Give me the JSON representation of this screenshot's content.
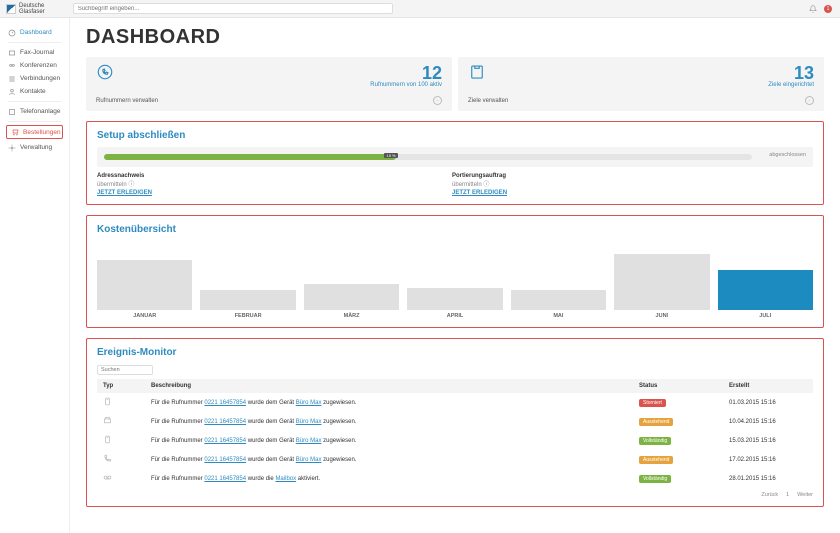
{
  "logo": {
    "line1": "Deutsche",
    "line2": "Glasfaser"
  },
  "search_placeholder": "Suchbegriff eingeben...",
  "notif_count": "1",
  "sidebar": {
    "items": [
      {
        "label": "Dashboard"
      },
      {
        "label": "Fax-Journal"
      },
      {
        "label": "Konferenzen"
      },
      {
        "label": "Verbindungen"
      },
      {
        "label": "Kontakte"
      },
      {
        "label": "Telefonanlage"
      },
      {
        "label": "Bestellungen"
      },
      {
        "label": "Verwaltung"
      }
    ]
  },
  "title": "DASHBOARD",
  "stats": [
    {
      "num": "12",
      "sub": "Rufnummern von 100 aktiv",
      "foot": "Rufnummern verwalten"
    },
    {
      "num": "13",
      "sub": "Ziele eingerichtet",
      "foot": "Ziele verwalten"
    }
  ],
  "setup": {
    "heading": "Setup abschließen",
    "percent": "15 %",
    "end": "abgeschlossen",
    "cols": [
      {
        "title": "Adressnachweis",
        "sub": "übermitteln ⓘ",
        "link": "JETZT ERLEDIGEN"
      },
      {
        "title": "Portierungsauftrag",
        "sub": "übermitteln ⓘ",
        "link": "JETZT ERLEDIGEN"
      }
    ]
  },
  "costs": {
    "heading": "Kostenübersicht"
  },
  "chart_data": {
    "type": "bar",
    "categories": [
      "JANUAR",
      "FEBRUAR",
      "MÄRZ",
      "APRIL",
      "MAI",
      "JUNI",
      "JULI"
    ],
    "values": [
      70,
      28,
      36,
      30,
      28,
      78,
      56
    ],
    "active_index": 6,
    "title": "Kostenübersicht",
    "xlabel": "",
    "ylabel": "",
    "ylim": [
      0,
      100
    ]
  },
  "events": {
    "heading": "Ereignis-Monitor",
    "search_placeholder": "Suchen",
    "headers": {
      "typ": "Typ",
      "desc": "Beschreibung",
      "status": "Status",
      "created": "Erstellt"
    },
    "rows": [
      {
        "icon": "phone-add",
        "pre": "Für die Rufnummer ",
        "num": "0221 16457854",
        "mid": " wurde dem Gerät ",
        "dev": "Büro Max",
        "post": " zugewiesen.",
        "status": "Storniert",
        "cls": "red",
        "date": "01.03.2015 15:16"
      },
      {
        "icon": "fax",
        "pre": "Für die Rufnummer ",
        "num": "0221 16457854",
        "mid": " wurde dem Gerät ",
        "dev": "Büro Max",
        "post": " zugewiesen.",
        "status": "Ausstehend",
        "cls": "orange",
        "date": "10.04.2015 15:16"
      },
      {
        "icon": "phone-add",
        "pre": "Für die Rufnummer ",
        "num": "0221 16457854",
        "mid": " wurde dem Gerät ",
        "dev": "Büro Max",
        "post": " zugewiesen.",
        "status": "Vollständig",
        "cls": "green",
        "date": "15.03.2015 15:16"
      },
      {
        "icon": "handset",
        "pre": "Für die Rufnummer ",
        "num": "0221 16457854",
        "mid": " wurde dem Gerät ",
        "dev": "Büro Max",
        "post": " zugewiesen.",
        "status": "Ausstehend",
        "cls": "orange",
        "date": "17.02.2015 15:16"
      },
      {
        "icon": "voicemail",
        "pre": "Für die Rufnummer ",
        "num": "0221 16457854",
        "mid": " wurde die ",
        "dev": "Mailbox",
        "post": " aktiviert.",
        "status": "Vollständig",
        "cls": "green",
        "date": "28.01.2015 15:16"
      }
    ],
    "pager": {
      "prev": "Zurück",
      "page": "1",
      "next": "Weiter"
    }
  }
}
